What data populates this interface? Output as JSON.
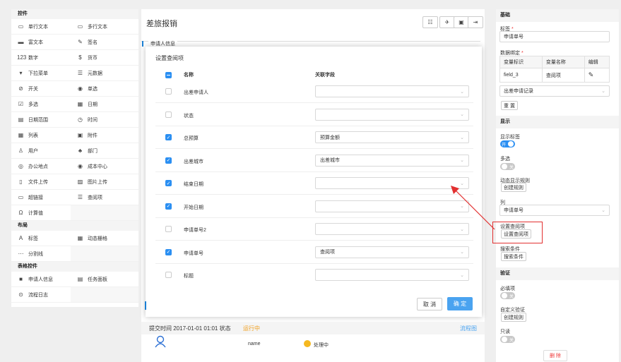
{
  "palette": {
    "sections": [
      {
        "title": "控件",
        "items": [
          {
            "icon": "single-line-icon",
            "glyph": "▭",
            "label": "单行文本"
          },
          {
            "icon": "multi-line-icon",
            "glyph": "▭",
            "label": "多行文本"
          },
          {
            "icon": "rich-text-icon",
            "glyph": "▬",
            "label": "富文本"
          },
          {
            "icon": "signature-icon",
            "glyph": "✎",
            "label": "签名"
          },
          {
            "icon": "number-icon",
            "glyph": "123",
            "label": "数字"
          },
          {
            "icon": "currency-icon",
            "glyph": "$",
            "label": "货币"
          },
          {
            "icon": "dropdown-icon",
            "glyph": "▾",
            "label": "下拉菜单"
          },
          {
            "icon": "metadata-icon",
            "glyph": "☰",
            "label": "元数据"
          },
          {
            "icon": "switch-icon",
            "glyph": "⊘",
            "label": "开关"
          },
          {
            "icon": "radio-icon",
            "glyph": "◉",
            "label": "单选"
          },
          {
            "icon": "checkbox-icon",
            "glyph": "☑",
            "label": "多选"
          },
          {
            "icon": "calendar-icon",
            "glyph": "▦",
            "label": "日期"
          },
          {
            "icon": "date-range-icon",
            "glyph": "▤",
            "label": "日期范围"
          },
          {
            "icon": "clock-icon",
            "glyph": "◷",
            "label": "时间"
          },
          {
            "icon": "table-icon",
            "glyph": "▦",
            "label": "列表"
          },
          {
            "icon": "attachment-icon",
            "glyph": "▣",
            "label": "附件"
          },
          {
            "icon": "user-icon",
            "glyph": "♙",
            "label": "用户"
          },
          {
            "icon": "department-icon",
            "glyph": "♣",
            "label": "部门"
          },
          {
            "icon": "location-icon",
            "glyph": "◎",
            "label": "办公地点"
          },
          {
            "icon": "cost-center-icon",
            "glyph": "◉",
            "label": "成本中心"
          },
          {
            "icon": "file-upload-icon",
            "glyph": "▯",
            "label": "文件上传"
          },
          {
            "icon": "image-upload-icon",
            "glyph": "▨",
            "label": "图片上传"
          },
          {
            "icon": "link-icon",
            "glyph": "▭",
            "label": "超链接"
          },
          {
            "icon": "lookup-icon",
            "glyph": "☰",
            "label": "查阅项"
          },
          {
            "icon": "formula-icon",
            "glyph": "Ω",
            "label": "计算值"
          }
        ]
      },
      {
        "title": "布局",
        "items": [
          {
            "icon": "label-icon",
            "glyph": "A",
            "label": "标签"
          },
          {
            "icon": "dynamic-grid-icon",
            "glyph": "▦",
            "label": "动态栅格"
          },
          {
            "icon": "divider-icon",
            "glyph": "⋯",
            "label": "分割线"
          }
        ]
      },
      {
        "title": "表格控件",
        "items": [
          {
            "icon": "applicant-icon",
            "glyph": "■",
            "label": "申请人信息"
          },
          {
            "icon": "task-panel-icon",
            "glyph": "▤",
            "label": "任务面板"
          },
          {
            "icon": "process-log-icon",
            "glyph": "⊙",
            "label": "流程日志"
          }
        ]
      }
    ]
  },
  "header": {
    "title": "差旅报销",
    "behind_section": "申请人信息"
  },
  "modal": {
    "title": "设置查阅项",
    "col_name": "名称",
    "col_field": "关联字段",
    "rows": [
      {
        "name": "出差申请人",
        "checked": false,
        "field": ""
      },
      {
        "name": "状态",
        "checked": false,
        "field": ""
      },
      {
        "name": "总预算",
        "checked": true,
        "field": "预算金额"
      },
      {
        "name": "出差城市",
        "checked": true,
        "field": "出差城市"
      },
      {
        "name": "结束日期",
        "checked": true,
        "field": ""
      },
      {
        "name": "开始日期",
        "checked": true,
        "field": ""
      },
      {
        "name": "申请单号2",
        "checked": false,
        "field": ""
      },
      {
        "name": "申请单号",
        "checked": true,
        "field": "查阅项"
      },
      {
        "name": "标题",
        "checked": false,
        "field": ""
      }
    ],
    "cancel": "取 消",
    "ok": "确 定"
  },
  "subform": {
    "time_line": "提交时间  2017-01-01 01:01  状态",
    "status": "运行中",
    "flow_link": "流程图",
    "name": "name",
    "process": "处理中"
  },
  "right": {
    "basic_title": "基础",
    "label_title": "标签",
    "label_value": "申请单号",
    "binding_title": "数据绑定",
    "binding_cols": [
      "变量标识",
      "变量名称",
      "编辑"
    ],
    "binding_row": [
      "field_3",
      "查阅项"
    ],
    "source_value": "出差申请记录",
    "reset": "重 置",
    "display_title": "显示",
    "show_label": "显示标签",
    "toggle_on": "开",
    "toggle_off": "关",
    "multi": "多选",
    "dyn_rule": "动态显示规则",
    "create_rule": "创建规则",
    "col": "列",
    "col_value": "申请单号",
    "set_lookup_label": "设置查阅项",
    "set_lookup_btn": "设置查阅项",
    "search_cond_label": "搜索条件",
    "search_cond_btn": "搜索条件",
    "validate_title": "验证",
    "required": "必填项",
    "custom_validate": "自定义验证",
    "readonly": "只读",
    "delete": "删 除"
  },
  "colors": {
    "accent": "#2b8ff2",
    "status": "#f0a020",
    "danger": "#e23030"
  }
}
